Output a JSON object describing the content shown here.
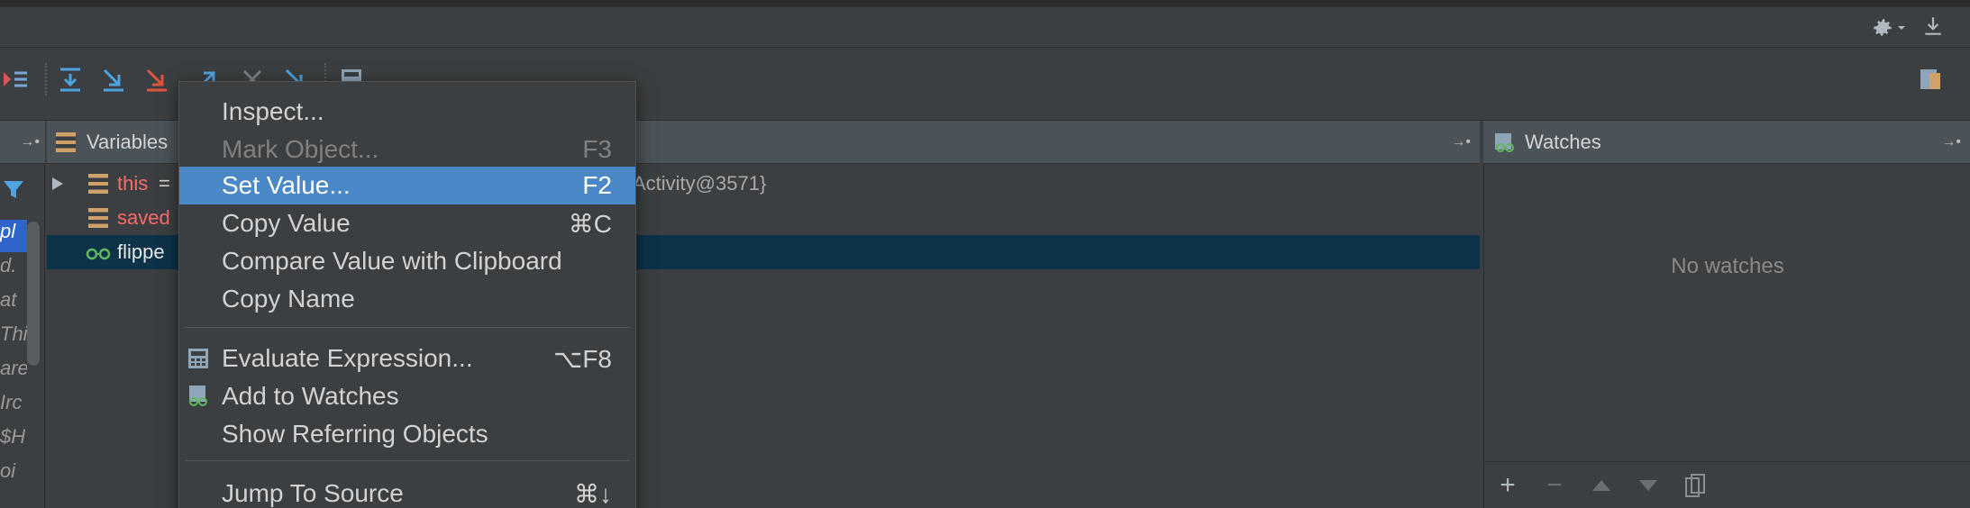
{
  "panels": {
    "variables_title": "Variables",
    "watches_title": "Watches",
    "no_watches": "No watches"
  },
  "frames": {
    "rows": [
      "pl",
      "d.",
      "at",
      "Thi",
      "are",
      "Irc",
      "$H",
      "oi"
    ]
  },
  "variables": {
    "rows": [
      {
        "name": "this",
        "rest": " =",
        "value": "Activity@3571}",
        "expandable": true,
        "highlighted": false
      },
      {
        "name": "saved",
        "rest": "",
        "value": "",
        "expandable": false,
        "highlighted": false
      },
      {
        "name": "flippe",
        "rest": "",
        "value": "",
        "expandable": false,
        "highlighted": true
      }
    ]
  },
  "context_menu": {
    "items": [
      {
        "label": "Inspect...",
        "shortcut": "",
        "disabled": false,
        "selected": false
      },
      {
        "label": "Mark Object...",
        "shortcut": "F3",
        "disabled": true,
        "selected": false
      },
      {
        "label": "Set Value...",
        "shortcut": "F2",
        "disabled": false,
        "selected": true
      },
      {
        "label": "Copy Value",
        "shortcut": "⌘C",
        "disabled": false,
        "selected": false
      },
      {
        "label": "Compare Value with Clipboard",
        "shortcut": "",
        "disabled": false,
        "selected": false
      },
      {
        "label": "Copy Name",
        "shortcut": "",
        "disabled": false,
        "selected": false
      },
      {
        "label": "Evaluate Expression...",
        "shortcut": "⌥F8",
        "disabled": false,
        "selected": false,
        "icon": "calculator-icon"
      },
      {
        "label": "Add to Watches",
        "shortcut": "",
        "disabled": false,
        "selected": false,
        "icon": "glasses-icon"
      },
      {
        "label": "Show Referring Objects",
        "shortcut": "",
        "disabled": false,
        "selected": false
      },
      {
        "label": "Jump To Source",
        "shortcut": "⌘↓",
        "disabled": false,
        "selected": false
      }
    ]
  },
  "colors": {
    "accent_selected": "#4a88c7",
    "panel_header": "#4b5359",
    "highlight_row": "#0d3349",
    "variable_red": "#ff6b68"
  }
}
